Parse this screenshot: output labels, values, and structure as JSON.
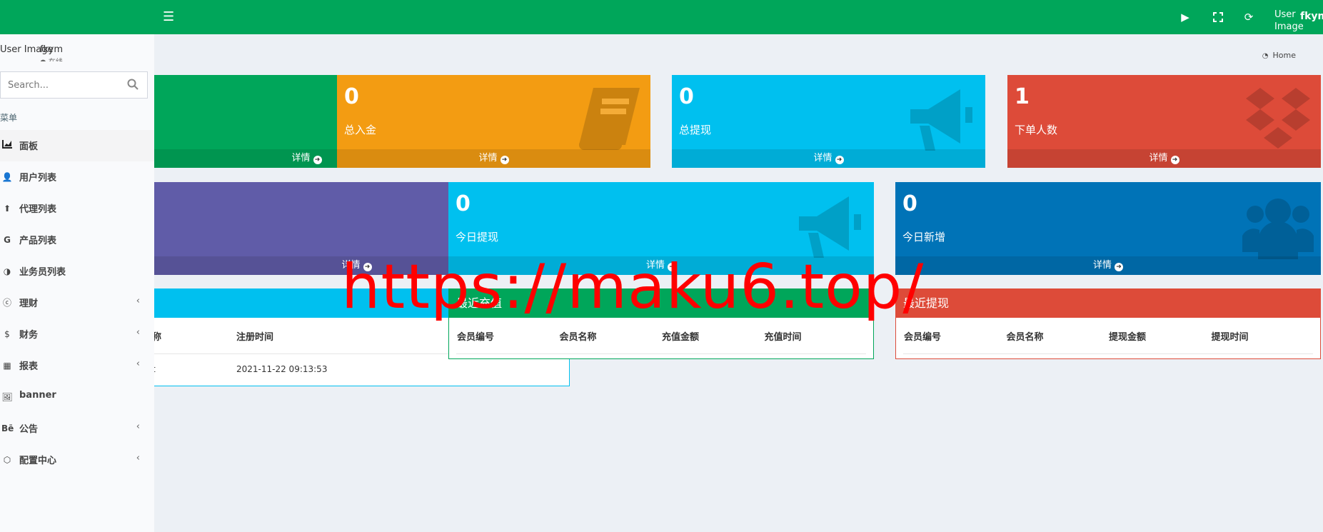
{
  "header": {
    "username": "fkym",
    "avatar_alt": "User Image"
  },
  "breadcrumb": {
    "home": "Home"
  },
  "sidebar": {
    "user_alt": "User Image",
    "user_name": "fkym",
    "search_placeholder": "Search...",
    "menu_header": "菜单",
    "items": [
      {
        "label": "面板",
        "icon": "dashboard-icon",
        "active": true
      },
      {
        "label": "用户列表",
        "icon": "user-icon"
      },
      {
        "label": "代理列表",
        "icon": "circle-arrow-icon"
      },
      {
        "label": "产品列表",
        "icon": "google-icon"
      },
      {
        "label": "业务员列表",
        "icon": "half-circle-icon"
      },
      {
        "label": "理财",
        "icon": "cc-icon",
        "has_children": true
      },
      {
        "label": "财务",
        "icon": "dollar-icon",
        "has_children": true
      },
      {
        "label": "报表",
        "icon": "calculator-icon",
        "has_children": true
      },
      {
        "label": "banner",
        "icon": "image-icon"
      },
      {
        "label": "公告",
        "icon": "behance-icon",
        "has_children": true
      },
      {
        "label": "配置中心",
        "icon": "gear-hex-icon",
        "has_children": true
      }
    ]
  },
  "stats_row1": [
    {
      "value": "",
      "label": "",
      "more": "详情",
      "color": "#00a65a",
      "icon": "cart-icon"
    },
    {
      "value": "0",
      "label": "总入金",
      "more": "详情",
      "color": "#f39c12",
      "icon": "book-icon"
    },
    {
      "value": "0",
      "label": "总提现",
      "more": "详情",
      "color": "#00c0ef",
      "icon": "bullhorn-icon"
    },
    {
      "value": "1",
      "label": "下单人数",
      "more": "详情",
      "color": "#dd4b39",
      "icon": "dropbox-icon"
    }
  ],
  "stats_row2": [
    {
      "value": "",
      "label": "",
      "more": "详情",
      "color": "#605ca8",
      "icon": "c-icon"
    },
    {
      "value": "0",
      "label": "今日提现",
      "more": "详情",
      "color": "#00c0ef",
      "icon": "bullhorn-icon"
    },
    {
      "value": "0",
      "label": "今日新增",
      "more": "详情",
      "color": "#0073b7",
      "icon": "users-icon"
    }
  ],
  "panels": [
    {
      "title": "",
      "color": "#00c0ef",
      "columns": [
        "称",
        "注册时间"
      ],
      "rows": [
        [
          "t",
          "2021-11-22 09:13:53"
        ]
      ]
    },
    {
      "title": "最近充值",
      "color": "#00a65a",
      "columns": [
        "会员编号",
        "会员名称",
        "充值金额",
        "充值时间"
      ],
      "rows": []
    },
    {
      "title": "最近提现",
      "color": "#dd4b39",
      "columns": [
        "会员编号",
        "会员名称",
        "提现金额",
        "提现时间"
      ],
      "rows": []
    }
  ],
  "watermark": "https://maku6.top/"
}
